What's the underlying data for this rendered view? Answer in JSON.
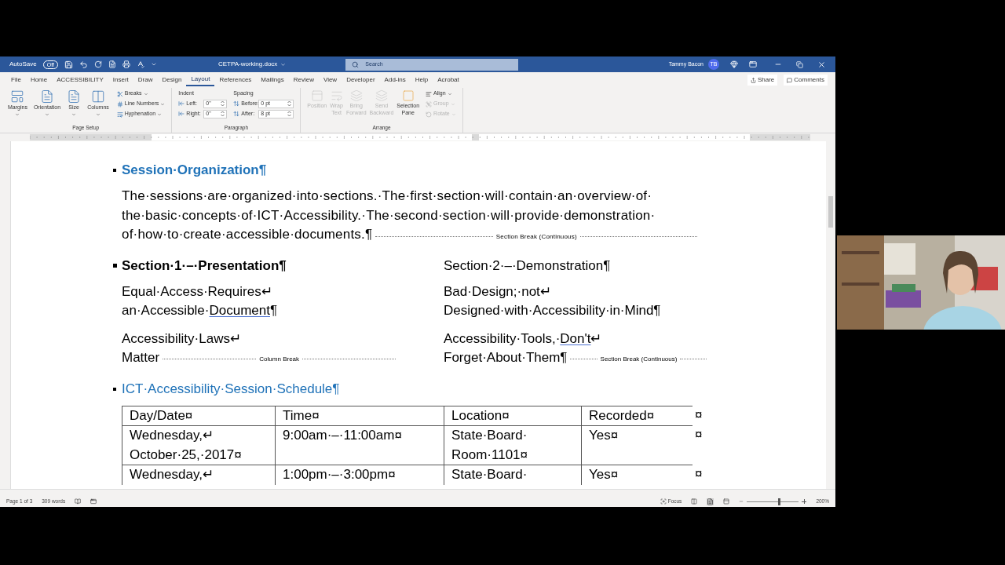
{
  "window": {
    "autosave_label": "AutoSave",
    "autosave_state": "Off",
    "autosave_on": false,
    "title": "CETPA-working.docx",
    "search_placeholder": "Search",
    "user": "Tammy Bacon",
    "user_initials": "TB"
  },
  "tabs": [
    {
      "label": "File",
      "selected": false
    },
    {
      "label": "Home",
      "selected": false
    },
    {
      "label": "ACCESSIBILITY",
      "selected": false
    },
    {
      "label": "Insert",
      "selected": false
    },
    {
      "label": "Draw",
      "selected": false
    },
    {
      "label": "Design",
      "selected": false
    },
    {
      "label": "Layout",
      "selected": true
    },
    {
      "label": "References",
      "selected": false
    },
    {
      "label": "Mailings",
      "selected": false
    },
    {
      "label": "Review",
      "selected": false
    },
    {
      "label": "View",
      "selected": false
    },
    {
      "label": "Developer",
      "selected": false
    },
    {
      "label": "Add-ins",
      "selected": false
    },
    {
      "label": "Help",
      "selected": false
    },
    {
      "label": "Acrobat",
      "selected": false
    }
  ],
  "share": "Share",
  "comments": "Comments",
  "page_setup": {
    "title": "Page Setup",
    "large": [
      "Margins",
      "Orientation",
      "Size",
      "Columns"
    ],
    "small": [
      "Breaks",
      "Line Numbers",
      "Hyphenation"
    ]
  },
  "paragraph": {
    "title": "Paragraph",
    "indent_label": "Indent",
    "spacing_label": "Spacing",
    "indent": [
      {
        "label": "Left:",
        "value": "0\""
      },
      {
        "label": "Right:",
        "value": "0\""
      }
    ],
    "spacing": [
      {
        "label": "Before:",
        "value": "0 pt"
      },
      {
        "label": "After:",
        "value": "8 pt"
      }
    ]
  },
  "arrange": {
    "title": "Arrange",
    "large": [
      {
        "lines": [
          "Position"
        ],
        "disabled": true
      },
      {
        "lines": [
          "Wrap",
          "Text"
        ],
        "disabled": true
      },
      {
        "lines": [
          "Bring",
          "Forward"
        ],
        "disabled": true
      },
      {
        "lines": [
          "Send",
          "Backward"
        ],
        "disabled": true
      },
      {
        "lines": [
          "Selection",
          "Pane"
        ],
        "disabled": false
      }
    ],
    "small": [
      {
        "label": "Align",
        "disabled": false
      },
      {
        "label": "Group",
        "disabled": true
      },
      {
        "label": "Rotate",
        "disabled": true
      }
    ]
  },
  "document": {
    "blocks": [
      {
        "kind": "heading",
        "text": "Session·Organization¶",
        "bold": true,
        "color": "#1f72b8"
      },
      {
        "kind": "paragraph",
        "lines": [
          "The·sessions·are·organized·into·sections.·The·first·section·will·contain·an·overview·of·",
          "the·basic·concepts·of·ICT·Accessibility.·The·second·section·will·provide·demonstration·",
          "of·how·to·create·accessible·documents.¶"
        ],
        "break_label": "Section Break (Continuous)"
      },
      {
        "kind": "columns",
        "columns": [
          {
            "heading": {
              "text": "Section·1·–·Presentation¶",
              "kind": "heading"
            },
            "paragraphs": [
              {
                "lines": [
                  [
                    {
                      "text": "Equal·Access·Requires↵",
                      "flagged": false
                    }
                  ],
                  [
                    {
                      "text": "an·Accessible·",
                      "flagged": false
                    },
                    {
                      "text": "Document",
                      "flagged": true
                    },
                    {
                      "text": "¶",
                      "flagged": false
                    }
                  ]
                ]
              },
              {
                "lines": [
                  [
                    {
                      "text": "Accessibility·Laws↵",
                      "flagged": false
                    }
                  ],
                  [
                    {
                      "text": "Matter",
                      "flagged": false
                    }
                  ]
                ],
                "break_label": "Column Break"
              }
            ]
          },
          {
            "heading": {
              "text": "Section·2·–·Demonstration¶",
              "kind": "plain"
            },
            "paragraphs": [
              {
                "lines": [
                  [
                    {
                      "text": "Bad·Design;·not↵",
                      "flagged": false
                    }
                  ],
                  [
                    {
                      "text": "Designed·with·Accessibility·in·Mind¶",
                      "flagged": false
                    }
                  ]
                ]
              },
              {
                "lines": [
                  [
                    {
                      "text": "Accessibility·Tools,·",
                      "flagged": false
                    },
                    {
                      "text": "Don't",
                      "flagged": true
                    },
                    {
                      "text": "↵",
                      "flagged": false
                    }
                  ],
                  [
                    {
                      "text": "Forget·About·Them¶",
                      "flagged": false
                    }
                  ]
                ],
                "break_label": "Section Break (Continuous)"
              }
            ]
          }
        ]
      },
      {
        "kind": "heading",
        "text": "ICT·Accessibility·Session·Schedule¶",
        "bold": false,
        "color": "#1f72b8"
      },
      {
        "kind": "table",
        "row_end": "¤",
        "columns": [
          "Day/Date¤",
          "Time¤",
          "Location¤",
          "Recorded¤"
        ],
        "rows": [
          [
            [
              "Wednesday,↵",
              "October·25,·2017¤"
            ],
            [
              "9:00am·–·11:00am¤"
            ],
            [
              "State·Board·",
              "Room·1101¤"
            ],
            [
              "Yes¤"
            ]
          ],
          [
            [
              "Wednesday,↵"
            ],
            [
              "1:00pm·–·3:00pm¤"
            ],
            [
              "State·Board·"
            ],
            [
              "Yes¤"
            ]
          ]
        ]
      }
    ]
  },
  "status_bar": {
    "page": "Page 1 of 3",
    "words": "309 words",
    "focus": "Focus",
    "zoom": "200%",
    "zoom_slider": {
      "level": 0.6
    }
  }
}
